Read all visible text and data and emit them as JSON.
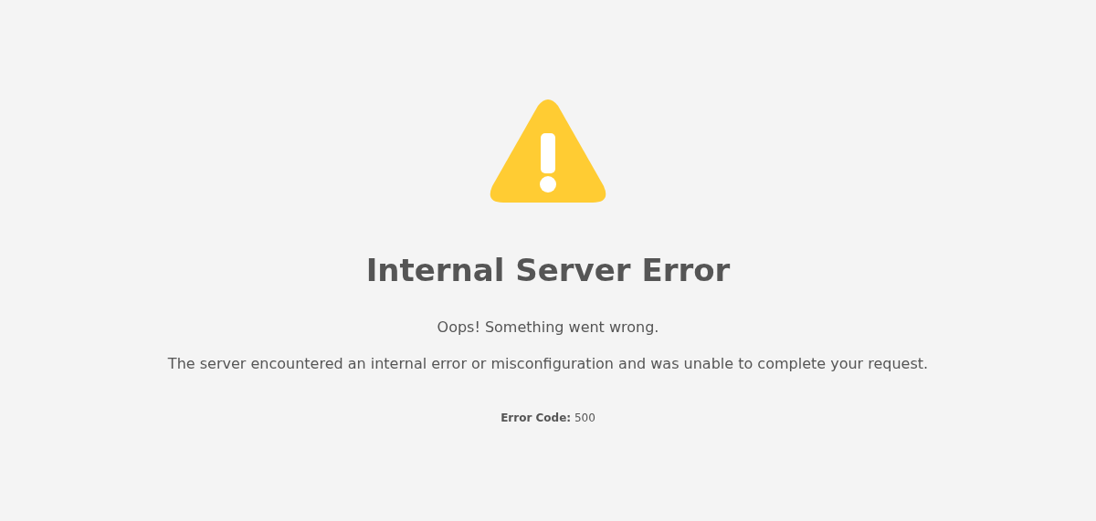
{
  "title": "Internal Server Error",
  "subtitle": "Oops! Something went wrong.",
  "message": "The server encountered an internal error or misconfiguration and was unable to complete your request.",
  "error_code": "**Error Code:** 500"
}
